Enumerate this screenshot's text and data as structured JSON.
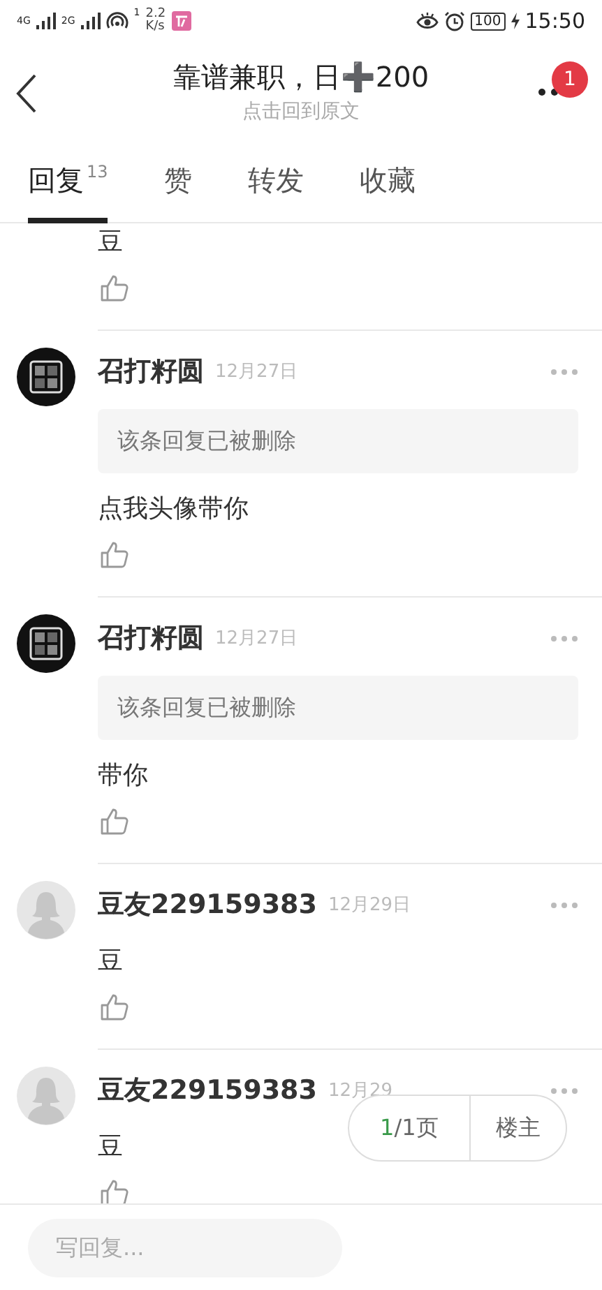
{
  "status_bar": {
    "signal_1": "4G",
    "signal_2": "2G",
    "wifi_badge": "1",
    "speed": "2.2",
    "speed_unit": "K/s",
    "battery": "100",
    "time": "15:50"
  },
  "header": {
    "title": "靠谱兼职，日➕200",
    "subtitle": "点击回到原文",
    "badge": "1"
  },
  "tabs": [
    {
      "label": "回复",
      "count": "13",
      "selected": true
    },
    {
      "label": "赞",
      "selected": false
    },
    {
      "label": "转发",
      "selected": false
    },
    {
      "label": "收藏",
      "selected": false
    }
  ],
  "comments": [
    {
      "kind": "partial",
      "text": "豆"
    },
    {
      "kind": "picture_avatar",
      "author": "召打籽圆",
      "date": "12月27日",
      "quote": "该条回复已被删除",
      "text": "点我头像带你"
    },
    {
      "kind": "picture_avatar",
      "author": "召打籽圆",
      "date": "12月27日",
      "quote": "该条回复已被删除",
      "text": "带你"
    },
    {
      "kind": "default_avatar",
      "author": "豆友229159383",
      "date": "12月29日",
      "text": "豆"
    },
    {
      "kind": "default_avatar",
      "author": "豆友229159383",
      "date": "12月29",
      "text": "豆"
    }
  ],
  "pager": {
    "current": "1",
    "total": "/1页",
    "owner": "楼主"
  },
  "reply": {
    "placeholder": "写回复..."
  }
}
